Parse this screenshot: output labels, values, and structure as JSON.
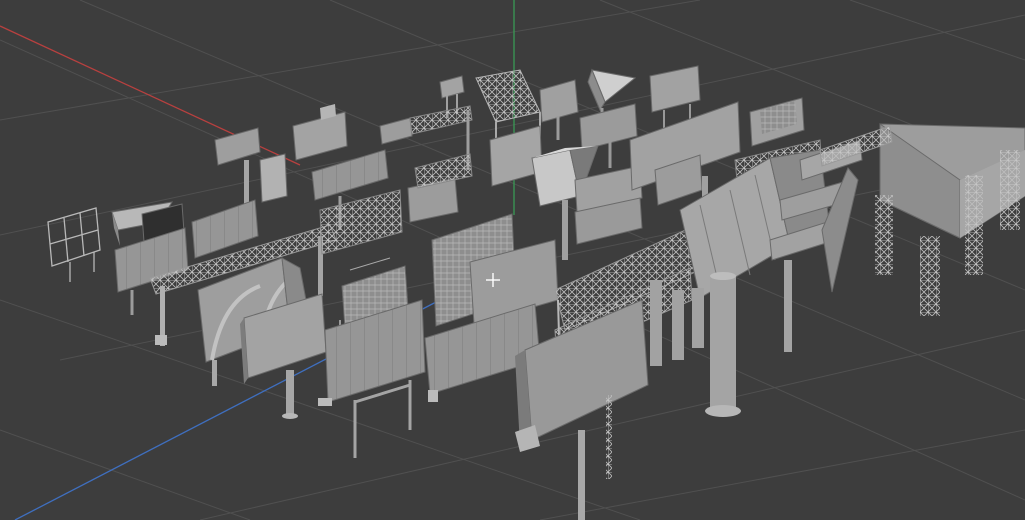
{
  "viewport": {
    "view": "perspective",
    "scene": "billboard-models",
    "colors": {
      "background": "#3d3d3d",
      "grid": "#505050",
      "x_axis": "#b8403f",
      "y_axis": "#3a9a54",
      "z_axis": "#3f6fbf",
      "model_face": "#9a9a9a",
      "model_light": "#b4b4b4",
      "model_dark": "#7a7a7a",
      "model_edge": "#5e5e5e",
      "cursor": "#ffffff"
    },
    "cursor_icon": "3d-cursor-crosshair"
  }
}
